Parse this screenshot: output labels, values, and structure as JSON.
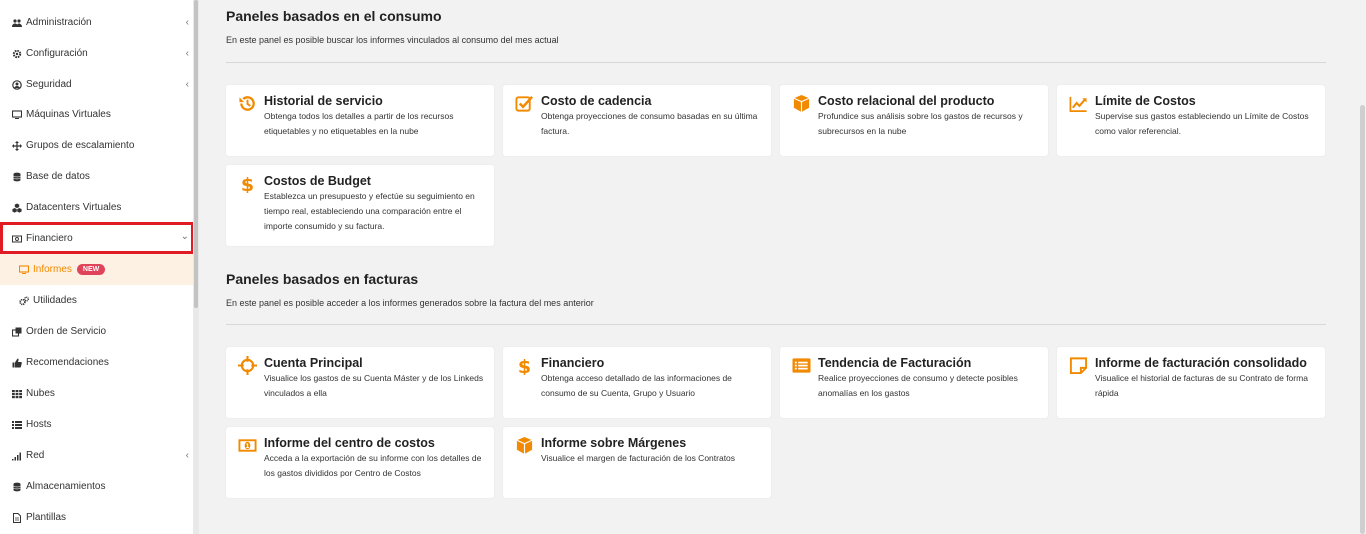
{
  "sidebar": {
    "items": [
      {
        "label": "Administración",
        "chevron": "‹"
      },
      {
        "label": "Configuración",
        "chevron": "‹"
      },
      {
        "label": "Seguridad",
        "chevron": "‹"
      },
      {
        "label": "Máquinas Virtuales"
      },
      {
        "label": "Grupos de escalamiento"
      },
      {
        "label": "Base de datos"
      },
      {
        "label": "Datacenters Virtuales"
      },
      {
        "label": "Financiero",
        "chevron": "⌄"
      },
      {
        "label": "Informes",
        "badge": "NEW"
      },
      {
        "label": "Utilidades"
      },
      {
        "label": "Orden de Servicio"
      },
      {
        "label": "Recomendaciones"
      },
      {
        "label": "Nubes"
      },
      {
        "label": "Hosts"
      },
      {
        "label": "Red",
        "chevron": "‹"
      },
      {
        "label": "Almacenamientos"
      },
      {
        "label": "Plantillas"
      }
    ]
  },
  "consumo": {
    "title": "Paneles basados en el consumo",
    "description": "En este panel es posible buscar los informes vinculados al consumo del mes actual",
    "cards": [
      {
        "title": "Historial de servicio",
        "description": "Obtenga todos los detalles a partir de los recursos etiquetables y no etiquetables en la nube",
        "icon": "history-icon"
      },
      {
        "title": "Costo de cadencia",
        "description": "Obtenga proyecciones de consumo basadas en su última factura.",
        "icon": "checkbox-icon"
      },
      {
        "title": "Costo relacional del producto",
        "description": "Profundice sus análisis sobre los gastos de recursos y subrecursos en la nube",
        "icon": "cube-icon"
      },
      {
        "title": "Límite de Costos",
        "description": "Supervise sus gastos estableciendo un Límite de Costos como valor referencial.",
        "icon": "line-chart-icon"
      },
      {
        "title": "Costos de Budget",
        "description": "Establezca un presupuesto y efectúe su seguimiento en tiempo real, estableciendo una comparación entre el importe consumido y su factura.",
        "icon": "dollar-icon"
      }
    ]
  },
  "facturas": {
    "title": "Paneles basados en facturas",
    "description": "En este panel es posible acceder a los informes generados sobre la factura del mes anterior",
    "cards": [
      {
        "title": "Cuenta Principal",
        "description": "Visualice los gastos de su Cuenta Máster y de los Linkeds vinculados a ella",
        "icon": "crosshair-icon"
      },
      {
        "title": "Financiero",
        "description": "Obtenga acceso detallado de las informaciones de consumo de su Cuenta, Grupo y Usuario",
        "icon": "dollar-icon"
      },
      {
        "title": "Tendencia de Facturación",
        "description": "Realice proyecciones de consumo y detecte posibles anomalías en los gastos",
        "icon": "list-alt-icon"
      },
      {
        "title": "Informe de facturación consolidado",
        "description": "Visualice el historial de facturas de su Contrato de forma rápida",
        "icon": "sticky-note-icon"
      },
      {
        "title": "Informe del centro de costos",
        "description": "Acceda a la exportación de su informe con los detalles de los gastos divididos por Centro de Costos",
        "icon": "money-icon"
      },
      {
        "title": "Informe sobre Márgenes",
        "description": "Visualice el margen de facturación de los Contratos",
        "icon": "cube-icon"
      }
    ]
  },
  "colors": {
    "accent": "#f18a00",
    "highlight": "#e01b24",
    "badge": "#e0445a",
    "active_bg": "#fdf1e4"
  }
}
